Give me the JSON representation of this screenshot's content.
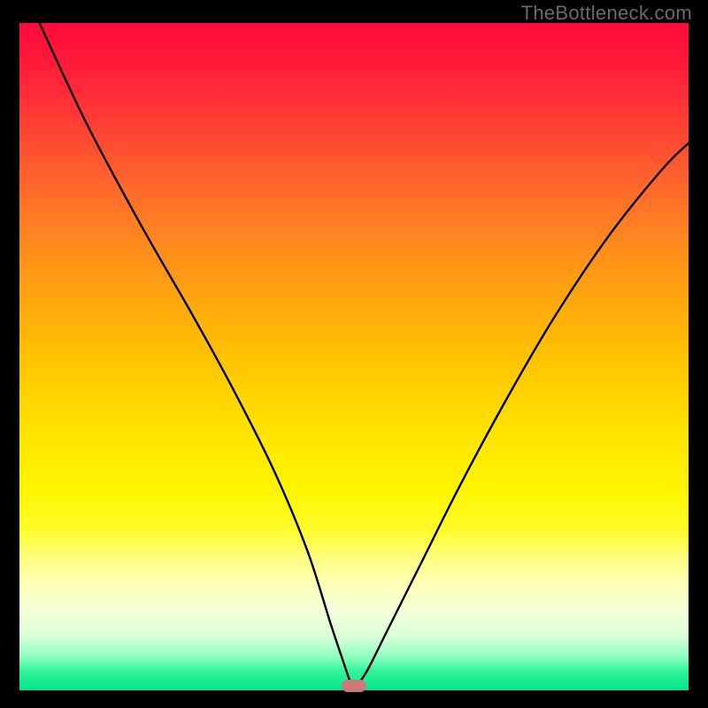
{
  "watermark_text": "TheBottleneck.com",
  "chart_data": {
    "type": "line",
    "title": "",
    "xlabel": "",
    "ylabel": "",
    "xlim": [
      0,
      100
    ],
    "ylim": [
      0,
      100
    ],
    "grid": false,
    "series": [
      {
        "name": "bottleneck-curve",
        "x": [
          3,
          10,
          18,
          26,
          32,
          38,
          43,
          46.5,
          48.5,
          49.7,
          50.3,
          52,
          55,
          60,
          66,
          73,
          80,
          88,
          96,
          100
        ],
        "y": [
          100,
          85,
          70,
          56,
          45,
          33,
          21,
          10,
          4,
          0.6,
          0.6,
          3,
          9,
          19,
          31,
          44,
          56,
          68,
          78,
          82
        ]
      }
    ],
    "marker": {
      "x_pct": 50,
      "y_pct": 0.6,
      "color": "#cf7878"
    },
    "background_gradient": {
      "top": "#ff0b3c",
      "bottom": "#00e58b"
    }
  }
}
